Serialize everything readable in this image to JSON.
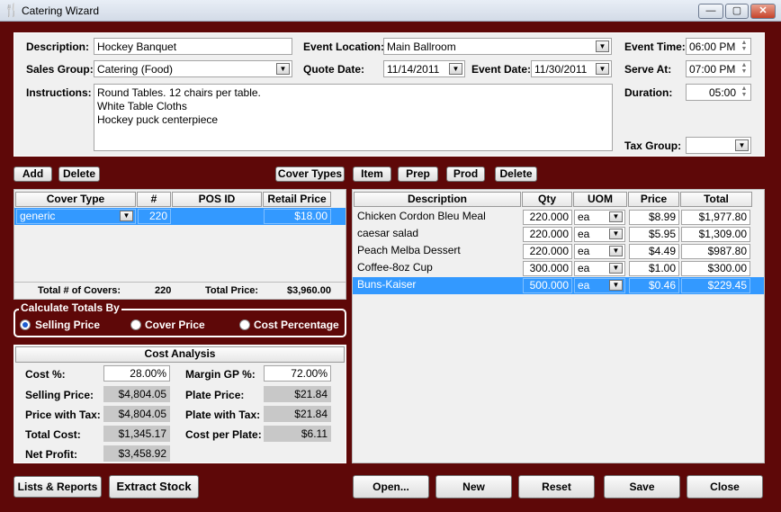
{
  "window": {
    "title": "Catering Wizard",
    "minimize": "—",
    "maximize": "▢",
    "close": "✕"
  },
  "header": {
    "description_label": "Description:",
    "description_value": "Hockey Banquet",
    "sales_group_label": "Sales Group:",
    "sales_group_value": "Catering  (Food)",
    "instructions_label": "Instructions:",
    "instructions_lines": [
      "Round Tables.  12 chairs per table.",
      "White Table Cloths",
      "Hockey puck centerpiece"
    ],
    "event_location_label": "Event Location:",
    "event_location_value": "Main Ballroom",
    "quote_date_label": "Quote Date:",
    "quote_date_value": "11/14/2011",
    "event_date_label": "Event Date:",
    "event_date_value": "11/30/2011",
    "event_time_label": "Event Time:",
    "event_time_value": "06:00 PM",
    "serve_at_label": "Serve At:",
    "serve_at_value": "07:00 PM",
    "duration_label": "Duration:",
    "duration_value": "05:00",
    "tax_group_label": "Tax Group:",
    "tax_group_value": ""
  },
  "covers_toolbar": {
    "add": "Add",
    "delete": "Delete",
    "cover_types": "Cover Types"
  },
  "items_toolbar": {
    "item": "Item",
    "prep": "Prep",
    "prod": "Prod",
    "delete": "Delete"
  },
  "covers_grid": {
    "headers": [
      "Cover Type",
      "#",
      "POS ID",
      "Retail Price"
    ],
    "rows": [
      {
        "cover_type": "generic",
        "count": "220",
        "pos_id": "",
        "retail_price": "$18.00"
      }
    ],
    "total_covers_label": "Total # of Covers:",
    "total_covers_value": "220",
    "total_price_label": "Total Price:",
    "total_price_value": "$3,960.00"
  },
  "calc_totals": {
    "legend": "Calculate Totals By",
    "options": [
      "Selling Price",
      "Cover Price",
      "Cost Percentage"
    ],
    "selected": "Selling Price"
  },
  "cost_analysis": {
    "title": "Cost Analysis",
    "cost_pct_label": "Cost %:",
    "cost_pct_value": "28.00%",
    "selling_price_label": "Selling Price:",
    "selling_price_value": "$4,804.05",
    "price_with_tax_label": "Price with Tax:",
    "price_with_tax_value": "$4,804.05",
    "total_cost_label": "Total Cost:",
    "total_cost_value": "$1,345.17",
    "net_profit_label": "Net Profit:",
    "net_profit_value": "$3,458.92",
    "margin_gp_label": "Margin GP %:",
    "margin_gp_value": "72.00%",
    "plate_price_label": "Plate Price:",
    "plate_price_value": "$21.84",
    "plate_with_tax_label": "Plate with Tax:",
    "plate_with_tax_value": "$21.84",
    "cost_per_plate_label": "Cost per Plate:",
    "cost_per_plate_value": "$6.11"
  },
  "items_grid": {
    "headers": [
      "Description",
      "Qty",
      "UOM",
      "Price",
      "Total"
    ],
    "rows": [
      {
        "description": "Chicken Cordon Bleu Meal",
        "qty": "220.000",
        "uom": "ea",
        "price": "$8.99",
        "total": "$1,977.80"
      },
      {
        "description": "caesar salad",
        "qty": "220.000",
        "uom": "ea",
        "price": "$5.95",
        "total": "$1,309.00"
      },
      {
        "description": "Peach Melba Dessert",
        "qty": "220.000",
        "uom": "ea",
        "price": "$4.49",
        "total": "$987.80"
      },
      {
        "description": "Coffee-8oz Cup",
        "qty": "300.000",
        "uom": "ea",
        "price": "$1.00",
        "total": "$300.00"
      },
      {
        "description": "Buns-Kaiser",
        "qty": "500.000",
        "uom": "ea",
        "price": "$0.46",
        "total": "$229.45"
      }
    ]
  },
  "footer": {
    "lists_reports": "Lists & Reports",
    "extract_stock": "Extract Stock",
    "open": "Open...",
    "new": "New",
    "reset": "Reset",
    "save": "Save",
    "close": "Close"
  }
}
